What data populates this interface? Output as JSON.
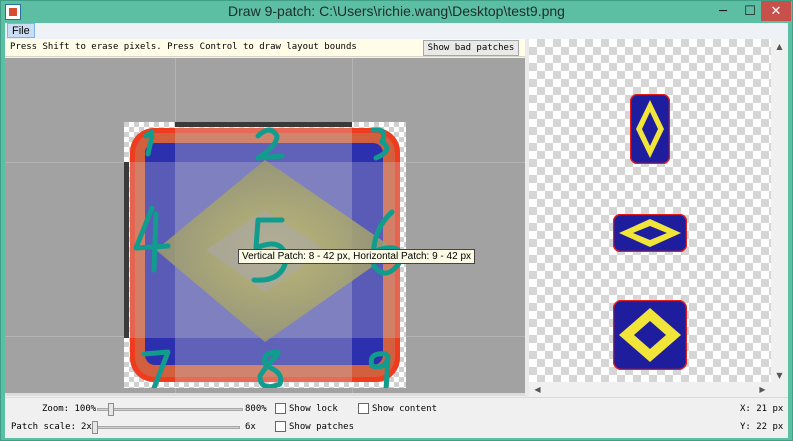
{
  "window": {
    "title": "Draw 9-patch: C:\\Users\\richie.wang\\Desktop\\test9.png",
    "min_glyph": "─",
    "max_glyph": "☐",
    "close_glyph": "✕"
  },
  "menu": {
    "file": "File"
  },
  "hint": {
    "text": "Press Shift to erase pixels. Press Control to draw layout bounds",
    "show_bad_patches": "Show bad patches"
  },
  "editor": {
    "tooltip": "Vertical Patch: 8 - 42 px, Horizontal Patch: 9 - 42 px",
    "handwritten_labels": [
      "1",
      "2",
      "3",
      "4",
      "5",
      "6",
      "7",
      "8",
      "9"
    ]
  },
  "status": {
    "zoom_label": "Zoom: 100%",
    "zoom_max": "800%",
    "zoom_fraction": 0.08,
    "patch_scale_label": "Patch scale:",
    "patch_scale_min": "2x",
    "patch_scale_max": "6x",
    "patch_scale_fraction": 0.0,
    "show_lock": "Show lock",
    "show_patches": "Show patches",
    "show_content": "Show content",
    "x_readout": "X: 21 px",
    "y_readout": "Y: 22 px"
  },
  "colors": {
    "title_bar": "#5cbfa4",
    "patch_blue": "#2c2fae",
    "patch_border": "#d2603e",
    "diamond_yellow": "#f1e53a",
    "label_teal": "#119c8e"
  }
}
